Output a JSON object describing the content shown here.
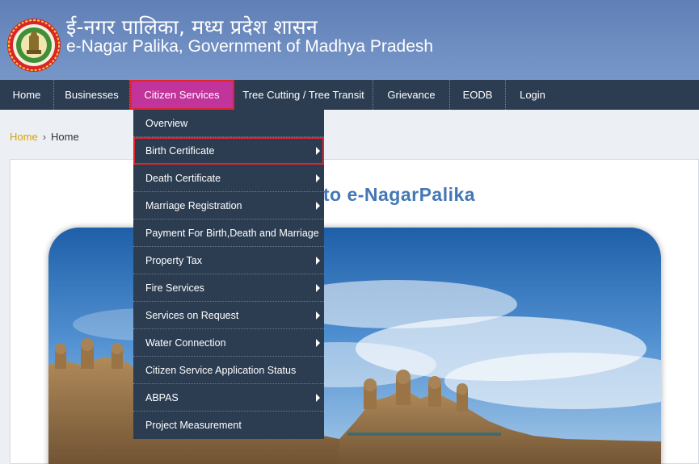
{
  "header": {
    "title_hindi": "ई-नगर पालिका, मध्य प्रदेश शासन",
    "title_english": "e-Nagar Palika, Government of Madhya Pradesh",
    "emblem_icon": "mp-government-emblem-icon"
  },
  "nav": {
    "items": [
      {
        "label": "Home"
      },
      {
        "label": "Businesses"
      },
      {
        "label": "Citizen Services",
        "active": true
      },
      {
        "label": "Tree Cutting / Tree Transit"
      },
      {
        "label": "Grievance"
      },
      {
        "label": "EODB"
      },
      {
        "label": "Login"
      }
    ]
  },
  "breadcrumb": {
    "home_link": "Home",
    "separator": "›",
    "current": "Home"
  },
  "main": {
    "welcome": "Welcome to e-NagarPalika"
  },
  "dropdown": {
    "items": [
      {
        "label": "Overview",
        "submenu": false
      },
      {
        "label": "Birth Certificate",
        "submenu": true,
        "highlighted": true
      },
      {
        "label": "Death Certificate",
        "submenu": true
      },
      {
        "label": "Marriage Registration",
        "submenu": true
      },
      {
        "label": "Payment For Birth,Death and Marriage",
        "submenu": false
      },
      {
        "label": "Property Tax",
        "submenu": true
      },
      {
        "label": "Fire Services",
        "submenu": true
      },
      {
        "label": "Services on Request",
        "submenu": true
      },
      {
        "label": "Water Connection",
        "submenu": true
      },
      {
        "label": "Citizen Service Application Status",
        "submenu": false
      },
      {
        "label": "ABPAS",
        "submenu": true
      },
      {
        "label": "Project Measurement",
        "submenu": false
      }
    ]
  },
  "colors": {
    "header_bg": "#6d8cbf",
    "nav_bg": "#2c3d52",
    "active_tab": "#c0349b",
    "highlight_outline": "#e0242e",
    "welcome_text": "#4477b5",
    "breadcrumb_link": "#d9a300"
  }
}
